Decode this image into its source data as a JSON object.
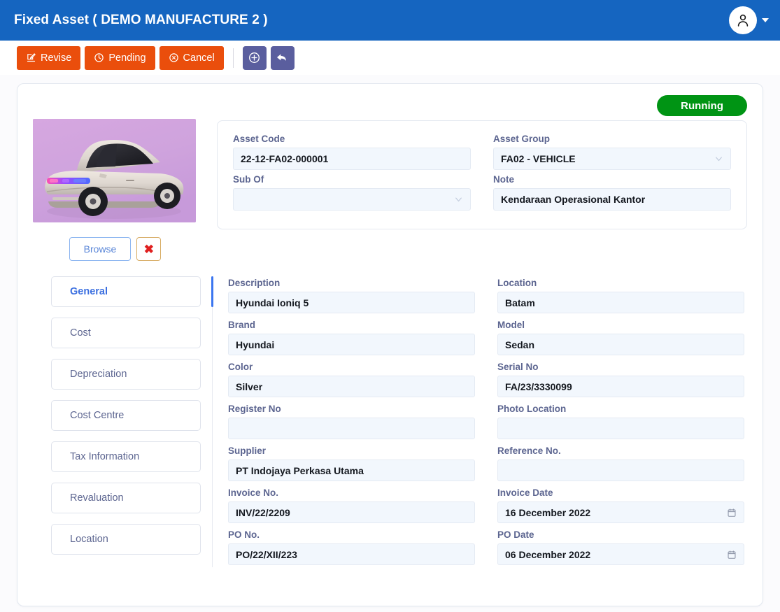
{
  "header": {
    "title": "Fixed Asset ( DEMO MANUFACTURE 2 )",
    "avatar_icon": "user-icon",
    "caret_icon": "chevron-down-icon"
  },
  "toolbar": {
    "buttons": [
      {
        "label": "Revise",
        "icon": "edit-square-icon",
        "style": "orange"
      },
      {
        "label": "Pending",
        "icon": "clock-icon",
        "style": "orange"
      },
      {
        "label": "Cancel",
        "icon": "circle-x-icon",
        "style": "orange"
      }
    ],
    "icon_buttons": [
      {
        "label": "",
        "icon": "plus-circle-icon",
        "style": "purple"
      },
      {
        "label": "",
        "icon": "undo-arrow-icon",
        "style": "purple"
      }
    ]
  },
  "status": {
    "label": "Running",
    "color": "#009414"
  },
  "photo": {
    "alt": "hyundai-ioniq-5-car-photo",
    "browse_label": "Browse",
    "delete_label": "✖",
    "delete_icon": "red-x-icon"
  },
  "asset_header": {
    "fields": [
      {
        "label": "Asset Code",
        "value": "22-12-FA02-000001",
        "type": "text",
        "placeholder": ""
      },
      {
        "label": "Asset Group",
        "value": "FA02 - VEHICLE",
        "type": "dropdown",
        "placeholder": ""
      },
      {
        "label": "Sub Of",
        "value": "",
        "type": "dropdown",
        "placeholder": ""
      },
      {
        "label": "Note",
        "value": "Kendaraan Operasional Kantor",
        "type": "text",
        "placeholder": ""
      }
    ]
  },
  "tabs": [
    {
      "label": "General",
      "active": true
    },
    {
      "label": "Cost",
      "active": false
    },
    {
      "label": "Depreciation",
      "active": false
    },
    {
      "label": "Cost Centre",
      "active": false
    },
    {
      "label": "Tax Information",
      "active": false
    },
    {
      "label": "Revaluation",
      "active": false
    },
    {
      "label": "Location",
      "active": false
    }
  ],
  "general_form": {
    "left": [
      {
        "label": "Description",
        "value": "Hyundai Ioniq 5",
        "type": "text",
        "placeholder": ""
      },
      {
        "label": "Brand",
        "value": "Hyundai",
        "type": "text",
        "placeholder": ""
      },
      {
        "label": "Color",
        "value": "Silver",
        "type": "text",
        "placeholder": ""
      },
      {
        "label": "Register No",
        "value": "",
        "type": "text",
        "placeholder": ""
      },
      {
        "label": "Supplier",
        "value": "PT Indojaya Perkasa Utama",
        "type": "text",
        "placeholder": ""
      },
      {
        "label": "Invoice No.",
        "value": "INV/22/2209",
        "type": "text",
        "placeholder": ""
      },
      {
        "label": "PO No.",
        "value": "PO/22/XII/223",
        "type": "text",
        "placeholder": ""
      }
    ],
    "right": [
      {
        "label": "Location",
        "value": "Batam",
        "type": "text",
        "placeholder": ""
      },
      {
        "label": "Model",
        "value": "Sedan",
        "type": "text",
        "placeholder": ""
      },
      {
        "label": "Serial No",
        "value": "FA/23/3330099",
        "type": "text",
        "placeholder": ""
      },
      {
        "label": "Photo Location",
        "value": "",
        "type": "text",
        "placeholder": ""
      },
      {
        "label": "Reference No.",
        "value": "",
        "type": "text",
        "placeholder": ""
      },
      {
        "label": "Invoice Date",
        "value": "16 December 2022",
        "type": "date",
        "placeholder": ""
      },
      {
        "label": "PO Date",
        "value": "06 December 2022",
        "type": "date",
        "placeholder": ""
      }
    ]
  }
}
